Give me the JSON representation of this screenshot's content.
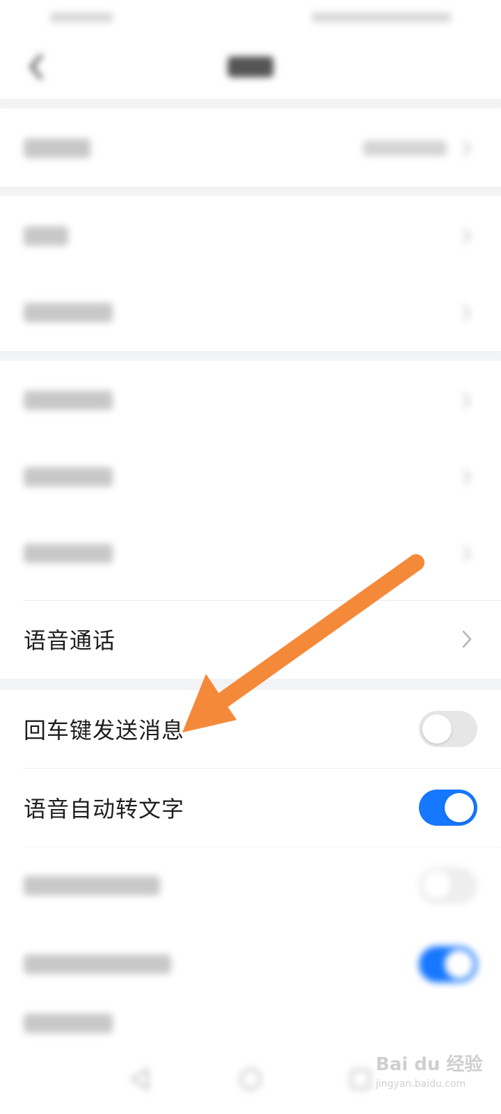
{
  "rows": {
    "voice_call": {
      "label": "语音通话"
    },
    "enter_send": {
      "label": "回车键发送消息",
      "toggle": "off"
    },
    "voice_to_text": {
      "label": "语音自动转文字",
      "toggle": "on"
    }
  },
  "colors": {
    "accent": "#1677ff",
    "arrow": "#f5893a",
    "toggle_off": "#e6e6e6",
    "section_gap": "#f2f3f5"
  },
  "icons": {
    "back": "chevron-left-icon",
    "row_arrow": "chevron-right-icon",
    "system_back": "triangle-back-icon",
    "system_home": "circle-home-icon",
    "system_recent": "square-recent-icon"
  },
  "watermark": {
    "brand": "Bai du 经验",
    "domain": "jingyan.baidu.com"
  }
}
